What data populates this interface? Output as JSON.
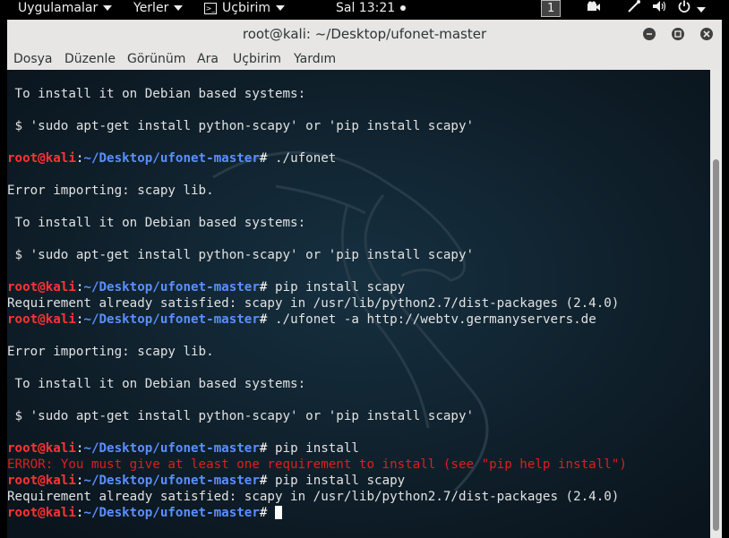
{
  "topbar": {
    "applications": "Uygulamalar",
    "places": "Yerler",
    "terminal_app": "Uçbirim",
    "clock": "Sal 13:21",
    "workspace": "1"
  },
  "window": {
    "title": "root@kali: ~/Desktop/ufonet-master",
    "menu": [
      "Dosya",
      "Düzenle",
      "Görünüm",
      "Ara",
      "Uçbirim",
      "Yardım"
    ]
  },
  "prompt": {
    "user": "root@kali",
    "colon": ":",
    "path": "~/Desktop/ufonet-master",
    "symbol": "# "
  },
  "lines": [
    {
      "kind": "out",
      "text": ""
    },
    {
      "kind": "out",
      "text": " To install it on Debian based systems:"
    },
    {
      "kind": "out",
      "text": ""
    },
    {
      "kind": "out",
      "text": " $ 'sudo apt-get install python-scapy' or 'pip install scapy'"
    },
    {
      "kind": "out",
      "text": ""
    },
    {
      "kind": "prompt",
      "cmd": "./ufonet"
    },
    {
      "kind": "out",
      "text": ""
    },
    {
      "kind": "out",
      "text": "Error importing: scapy lib."
    },
    {
      "kind": "out",
      "text": ""
    },
    {
      "kind": "out",
      "text": " To install it on Debian based systems:"
    },
    {
      "kind": "out",
      "text": ""
    },
    {
      "kind": "out",
      "text": " $ 'sudo apt-get install python-scapy' or 'pip install scapy'"
    },
    {
      "kind": "out",
      "text": ""
    },
    {
      "kind": "prompt",
      "cmd": "pip install scapy"
    },
    {
      "kind": "out",
      "text": "Requirement already satisfied: scapy in /usr/lib/python2.7/dist-packages (2.4.0)"
    },
    {
      "kind": "prompt",
      "cmd": "./ufonet -a http://webtv.germanyservers.de"
    },
    {
      "kind": "out",
      "text": ""
    },
    {
      "kind": "out",
      "text": "Error importing: scapy lib."
    },
    {
      "kind": "out",
      "text": ""
    },
    {
      "kind": "out",
      "text": " To install it on Debian based systems:"
    },
    {
      "kind": "out",
      "text": ""
    },
    {
      "kind": "out",
      "text": " $ 'sudo apt-get install python-scapy' or 'pip install scapy'"
    },
    {
      "kind": "out",
      "text": ""
    },
    {
      "kind": "prompt",
      "cmd": "pip install"
    },
    {
      "kind": "error",
      "text": "ERROR: You must give at least one requirement to install (see \"pip help install\")"
    },
    {
      "kind": "prompt",
      "cmd": "pip install scapy"
    },
    {
      "kind": "out",
      "text": "Requirement already satisfied: scapy in /usr/lib/python2.7/dist-packages (2.4.0)"
    },
    {
      "kind": "prompt",
      "cmd": "",
      "cursor": true
    }
  ],
  "colors": {
    "prompt_user": "#ff3333",
    "prompt_path": "#5a8fff",
    "error": "#dd1f1f",
    "terminal_bg": "#0d1b25"
  }
}
